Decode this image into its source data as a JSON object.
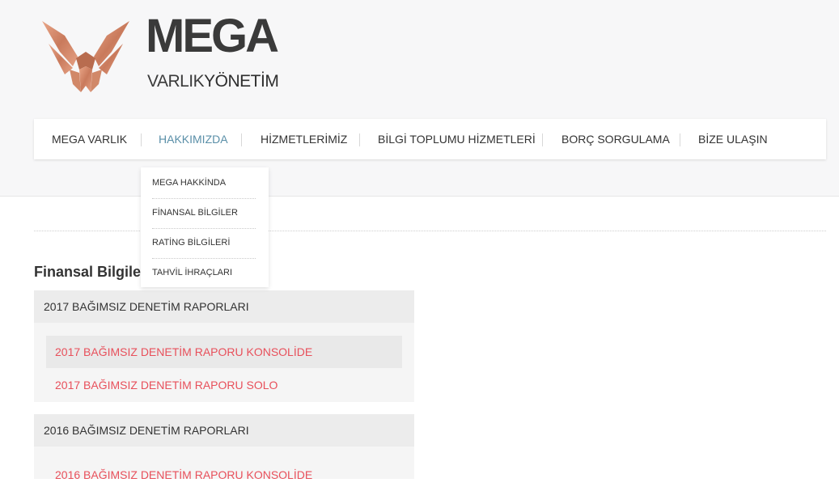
{
  "logo": {
    "big": "MEGA",
    "small_thin": "VARLIK",
    "small_bold": "YÖNETİM",
    "colors": {
      "icon": "#d98e70",
      "text": "#3a3a3a"
    }
  },
  "nav": {
    "items": [
      {
        "label": "MEGA VARLIK"
      },
      {
        "label": "HAKKIMIZDA"
      },
      {
        "label": "HİZMETLERİMİZ"
      },
      {
        "label": "BİLGİ TOPLUMU HİZMETLERİ"
      },
      {
        "label": "BORÇ SORGULAMA"
      },
      {
        "label": "BİZE ULAŞIN"
      }
    ],
    "active_color": "#5a8fa8"
  },
  "dropdown": {
    "items": [
      {
        "label": "MEGA HAKKİNDA"
      },
      {
        "label": "FİNANSAL BİLGİLER"
      },
      {
        "label": "RATİNG BİLGİLERİ"
      },
      {
        "label": "TAHVİL İHRAÇLARI"
      }
    ]
  },
  "main": {
    "title": "Finansal Bilgiler",
    "panels": [
      {
        "heading": "2017 BAĞIMSIZ DENETİM RAPORLARI",
        "links": [
          {
            "label": "2017 BAĞIMSIZ DENETİM RAPORU KONSOLİDE"
          },
          {
            "label": "2017 BAĞIMSIZ DENETİM RAPORU SOLO"
          }
        ]
      },
      {
        "heading": "2016 BAĞIMSIZ DENETİM RAPORLARI",
        "links": [
          {
            "label": "2016 BAĞIMSIZ DENETİM RAPORU KONSOLİDE"
          }
        ]
      }
    ],
    "link_color": "#e8505b"
  }
}
